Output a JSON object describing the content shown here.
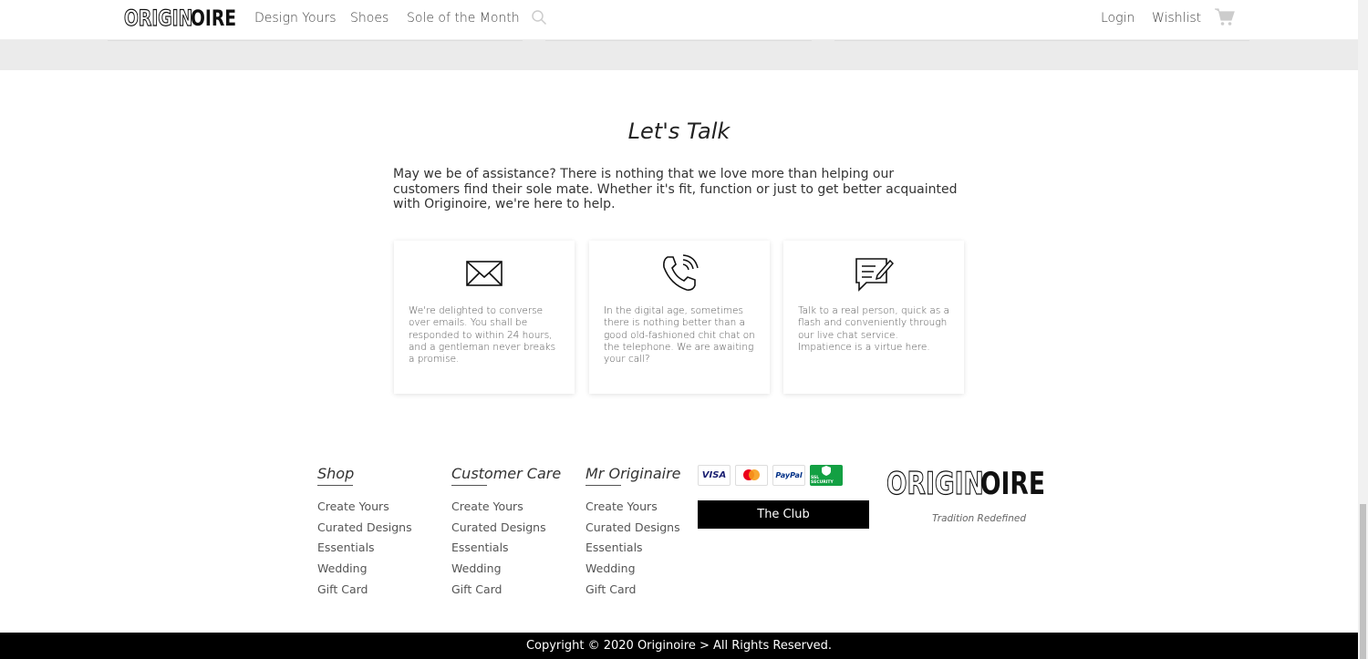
{
  "header": {
    "logo_outline": "ORIGIN",
    "logo_solid": "OIRE",
    "nav": [
      "Design Yours",
      "Shoes",
      "Sole of the Month"
    ],
    "login": "Login",
    "wishlist": "Wishlist"
  },
  "talk": {
    "title": "Let's Talk",
    "intro": "May we be of assistance? There is nothing that we love more than helping our customers find their sole mate. Whether it's fit, function or just to get better acquainted with Originoire, we're here to help.",
    "cards": [
      {
        "icon": "envelope-icon",
        "text": "We're delighted to converse over emails. You shall be responded to within 24 hours, and a gentleman never breaks a promise."
      },
      {
        "icon": "phone-icon",
        "text": "In the digital age, sometimes there is nothing better than a good old-fashioned chit chat on the telephone. We are awaiting your call?"
      },
      {
        "icon": "chat-icon",
        "text": "Talk to a real person, quick as a flash and conveniently through our live chat service. Impatience is a virtue here."
      }
    ]
  },
  "footer": {
    "columns": [
      {
        "heading": "Shop",
        "links": [
          "Create Yours",
          "Curated Designs",
          "Essentials",
          "Wedding",
          "Gift Card"
        ]
      },
      {
        "heading": "Customer Care",
        "links": [
          "Create Yours",
          "Curated Designs",
          "Essentials",
          "Wedding",
          "Gift Card"
        ]
      },
      {
        "heading": "Mr Originaire",
        "links": [
          "Create Yours",
          "Curated Designs",
          "Essentials",
          "Wedding",
          "Gift Card"
        ]
      }
    ],
    "payment_badges": [
      "VISA",
      "mastercard",
      "PayPal",
      "SSL SECURITY"
    ],
    "club_button": "The Club",
    "logo_outline": "ORIGIN",
    "logo_solid": "OIRE",
    "tagline": "Tradition Redefined",
    "copyright": "Copyright © 2020 Originoire > All Rights Reserved."
  }
}
